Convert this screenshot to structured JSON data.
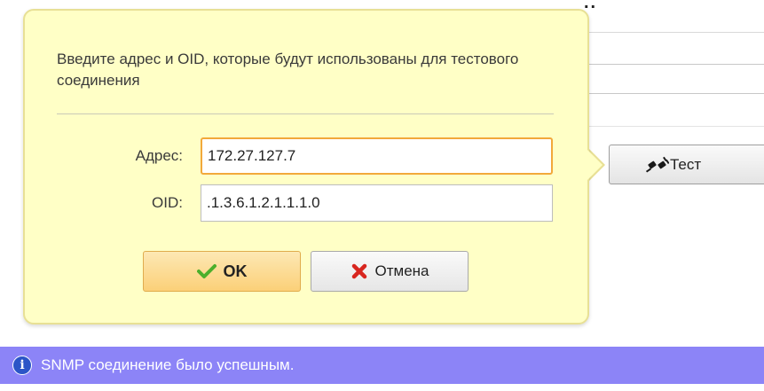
{
  "background_window": {
    "test_button_label": "Тест"
  },
  "dialog": {
    "instruction": "Введите адрес и OID, которые будут использованы для тестового соединения",
    "address_label": "Адрес:",
    "address_value": "172.27.127.7",
    "oid_label": "OID:",
    "oid_value": ".1.3.6.1.2.1.1.1.0",
    "ok_label": "OK",
    "cancel_label": "Отмена",
    "colors": {
      "popup_background": "#ffffc6",
      "focus_border": "#f2a93b",
      "ok_icon": "#4caf2c",
      "cancel_icon": "#d8261f"
    }
  },
  "status": {
    "message": "SNMP соединение было успешным.",
    "icon": "info-icon",
    "background_color": "#8c84f7"
  }
}
